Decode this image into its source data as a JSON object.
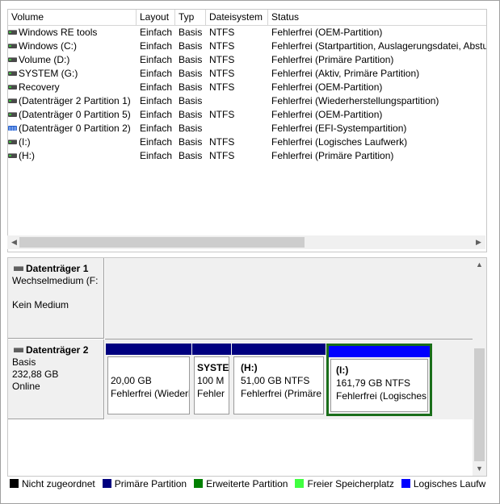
{
  "columns": [
    "Volume",
    "Layout",
    "Typ",
    "Dateisystem",
    "Status"
  ],
  "volumes": [
    {
      "name": "Windows RE tools",
      "layout": "Einfach",
      "type": "Basis",
      "fs": "NTFS",
      "status": "Fehlerfrei (OEM-Partition)",
      "icon": "disk-icon"
    },
    {
      "name": "Windows (C:)",
      "layout": "Einfach",
      "type": "Basis",
      "fs": "NTFS",
      "status": "Fehlerfrei (Startpartition, Auslagerungsdatei, Absturz",
      "icon": "disk-icon"
    },
    {
      "name": "Volume (D:)",
      "layout": "Einfach",
      "type": "Basis",
      "fs": "NTFS",
      "status": "Fehlerfrei (Primäre Partition)",
      "icon": "disk-icon"
    },
    {
      "name": "SYSTEM (G:)",
      "layout": "Einfach",
      "type": "Basis",
      "fs": "NTFS",
      "status": "Fehlerfrei (Aktiv, Primäre Partition)",
      "icon": "disk-icon"
    },
    {
      "name": "Recovery",
      "layout": "Einfach",
      "type": "Basis",
      "fs": "NTFS",
      "status": "Fehlerfrei (OEM-Partition)",
      "icon": "disk-icon"
    },
    {
      "name": "(Datenträger 2 Partition 1)",
      "layout": "Einfach",
      "type": "Basis",
      "fs": "",
      "status": "Fehlerfrei (Wiederherstellungspartition)",
      "icon": "disk-icon"
    },
    {
      "name": "(Datenträger 0 Partition 5)",
      "layout": "Einfach",
      "type": "Basis",
      "fs": "NTFS",
      "status": "Fehlerfrei (OEM-Partition)",
      "icon": "disk-icon"
    },
    {
      "name": "(Datenträger 0 Partition 2)",
      "layout": "Einfach",
      "type": "Basis",
      "fs": "",
      "status": "Fehlerfrei (EFI-Systempartition)",
      "icon": "efi-disk-icon"
    },
    {
      "name": "(I:)",
      "layout": "Einfach",
      "type": "Basis",
      "fs": "NTFS",
      "status": "Fehlerfrei (Logisches Laufwerk)",
      "icon": "disk-icon"
    },
    {
      "name": "(H:)",
      "layout": "Einfach",
      "type": "Basis",
      "fs": "NTFS",
      "status": "Fehlerfrei (Primäre Partition)",
      "icon": "disk-icon"
    }
  ],
  "disk1": {
    "title": "Datenträger 1",
    "subtitle": "Wechselmedium (F:",
    "state": "Kein Medium"
  },
  "disk2": {
    "title": "Datenträger 2",
    "type": "Basis",
    "size": "232,88 GB",
    "state": "Online",
    "partitions": [
      {
        "name": "",
        "size": "20,00 GB",
        "status": "Fehlerfrei (Wiederherstellungspartition)",
        "kind": "primary"
      },
      {
        "name": "SYSTE",
        "size": "100 M",
        "status": "Fehler",
        "kind": "primary"
      },
      {
        "name": "(H:)",
        "size": "51,00 GB NTFS",
        "status": "Fehlerfrei (Primäre",
        "kind": "primary"
      },
      {
        "name": "(I:)",
        "size": "161,79 GB NTFS",
        "status": "Fehlerfrei (Logisches",
        "kind": "logical",
        "selected": true
      }
    ]
  },
  "legend": [
    {
      "label": "Nicht zugeordnet",
      "color": "#000000"
    },
    {
      "label": "Primäre Partition",
      "color": "#00007f"
    },
    {
      "label": "Erweiterte Partition",
      "color": "#008000"
    },
    {
      "label": "Freier Speicherplatz",
      "color": "#40ff40"
    },
    {
      "label": "Logisches Laufwerk",
      "color": "#0000ff"
    }
  ],
  "colors": {
    "primary": "#00007f",
    "logical": "#0000ff",
    "selected_border": "#1a6e1a"
  }
}
